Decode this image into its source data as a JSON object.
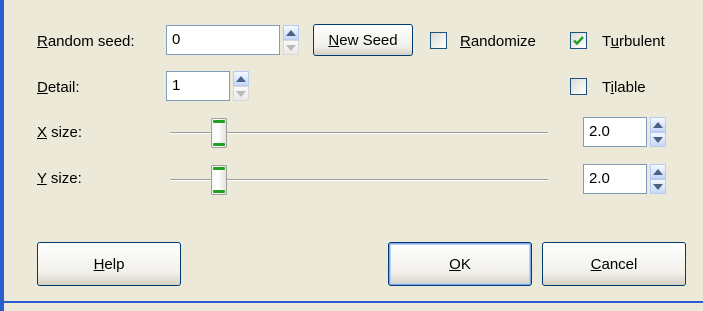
{
  "labels": {
    "random_seed_acc": "R",
    "random_seed_rest": "andom seed:",
    "detail_acc": "D",
    "detail_rest": "etail:",
    "xsize_acc": "X",
    "xsize_rest": " size:",
    "ysize_acc": "Y",
    "ysize_rest": " size:"
  },
  "fields": {
    "random_seed": "0",
    "detail": "1",
    "x_size": "2.0",
    "y_size": "2.0"
  },
  "slider_levels": {
    "x_size_fraction": 0.13,
    "y_size_fraction": 0.13
  },
  "buttons": {
    "new_seed_acc": "N",
    "new_seed_rest": "ew Seed",
    "help_acc": "H",
    "help_rest": "elp",
    "ok_acc": "O",
    "ok_rest": "K",
    "cancel_acc": "C",
    "cancel_rest": "ancel"
  },
  "checkboxes": {
    "randomize_acc": "R",
    "randomize_rest": "andomize",
    "randomize_checked": false,
    "turbulent_pre": "T",
    "turbulent_acc": "u",
    "turbulent_rest": "rbulent",
    "turbulent_checked": true,
    "tilable_pre": "T",
    "tilable_acc": "i",
    "tilable_rest": "lable",
    "tilable_checked": false
  },
  "colors": {
    "dialog_bg": "#ECE9D8",
    "window_border": "#2A5DCE",
    "check_mark": "#21A121",
    "slider_thumb_accent": "#21A121"
  }
}
